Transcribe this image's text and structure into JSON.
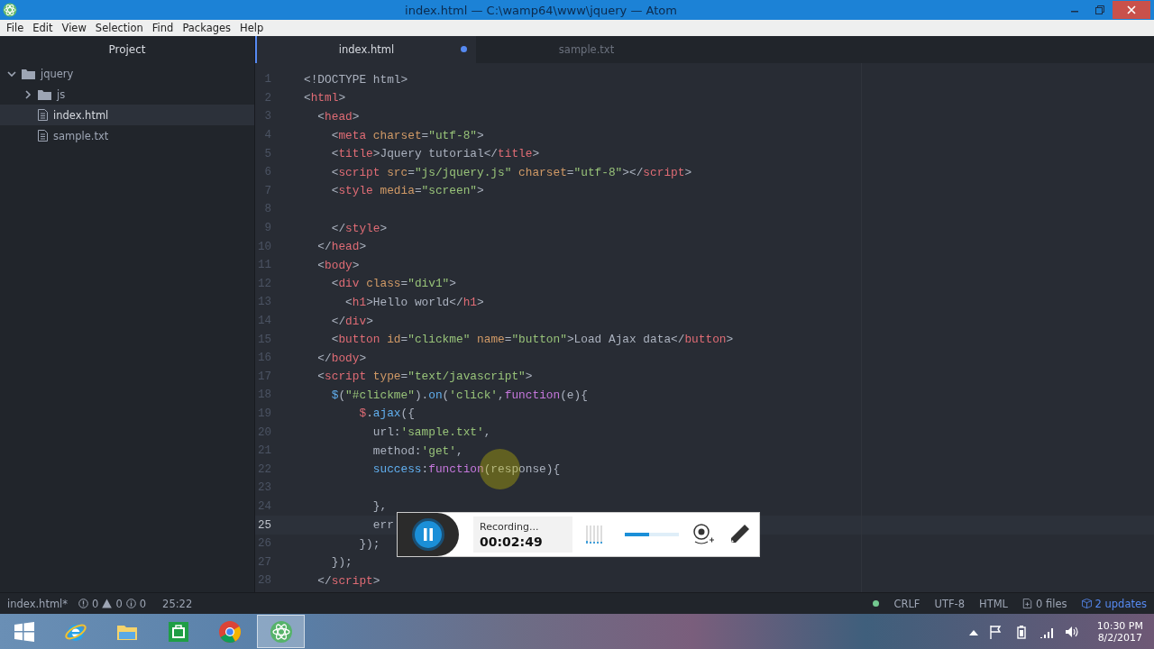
{
  "window": {
    "title": "index.html — C:\\wamp64\\www\\jquery — Atom"
  },
  "menu": [
    "File",
    "Edit",
    "View",
    "Selection",
    "Find",
    "Packages",
    "Help"
  ],
  "sidebar": {
    "title": "Project",
    "tree": [
      {
        "label": "jquery",
        "kind": "folder",
        "expanded": true,
        "selected": false,
        "children": [
          {
            "label": "js",
            "kind": "folder",
            "expanded": false,
            "selected": false
          },
          {
            "label": "index.html",
            "kind": "file",
            "selected": true
          },
          {
            "label": "sample.txt",
            "kind": "file",
            "selected": false
          }
        ]
      }
    ]
  },
  "tabs": [
    {
      "label": "index.html",
      "selected": true,
      "modified": true
    },
    {
      "label": "sample.txt",
      "selected": false,
      "modified": false
    }
  ],
  "code": [
    {
      "number": "1",
      "tokens": [
        {
          "kind": "plain",
          "text": "<!DOCTYPE html>"
        }
      ]
    },
    {
      "number": "2",
      "tokens": [
        {
          "kind": "plain",
          "text": "<"
        },
        {
          "kind": "tag",
          "text": "html"
        },
        {
          "kind": "plain",
          "text": ">"
        }
      ]
    },
    {
      "number": "3",
      "tokens": [
        {
          "kind": "plain",
          "text": "  <"
        },
        {
          "kind": "tag",
          "text": "head"
        },
        {
          "kind": "plain",
          "text": ">"
        }
      ]
    },
    {
      "number": "4",
      "tokens": [
        {
          "kind": "plain",
          "text": "    <"
        },
        {
          "kind": "tag",
          "text": "meta"
        },
        {
          "kind": "attr",
          "text": " charset"
        },
        {
          "kind": "plain",
          "text": "="
        },
        {
          "kind": "string",
          "text": "\"utf-8\""
        },
        {
          "kind": "plain",
          "text": ">"
        }
      ]
    },
    {
      "number": "5",
      "tokens": [
        {
          "kind": "plain",
          "text": "    <"
        },
        {
          "kind": "tag",
          "text": "title"
        },
        {
          "kind": "plain",
          "text": ">Jquery tutorial</"
        },
        {
          "kind": "tag",
          "text": "title"
        },
        {
          "kind": "plain",
          "text": ">"
        }
      ]
    },
    {
      "number": "6",
      "tokens": [
        {
          "kind": "plain",
          "text": "    <"
        },
        {
          "kind": "tag",
          "text": "script"
        },
        {
          "kind": "attr",
          "text": " src"
        },
        {
          "kind": "plain",
          "text": "="
        },
        {
          "kind": "string",
          "text": "\"js/jquery.js\""
        },
        {
          "kind": "attr",
          "text": " charset"
        },
        {
          "kind": "plain",
          "text": "="
        },
        {
          "kind": "string",
          "text": "\"utf-8\""
        },
        {
          "kind": "plain",
          "text": "></"
        },
        {
          "kind": "tag",
          "text": "script"
        },
        {
          "kind": "plain",
          "text": ">"
        }
      ]
    },
    {
      "number": "7",
      "tokens": [
        {
          "kind": "plain",
          "text": "    <"
        },
        {
          "kind": "tag",
          "text": "style"
        },
        {
          "kind": "attr",
          "text": " media"
        },
        {
          "kind": "plain",
          "text": "="
        },
        {
          "kind": "string",
          "text": "\"screen\""
        },
        {
          "kind": "plain",
          "text": ">"
        }
      ]
    },
    {
      "number": "8"
    },
    {
      "number": "9",
      "tokens": [
        {
          "kind": "plain",
          "text": "    </"
        },
        {
          "kind": "tag",
          "text": "style"
        },
        {
          "kind": "plain",
          "text": ">"
        }
      ]
    },
    {
      "number": "10",
      "tokens": [
        {
          "kind": "plain",
          "text": "  </"
        },
        {
          "kind": "tag",
          "text": "head"
        },
        {
          "kind": "plain",
          "text": ">"
        }
      ]
    },
    {
      "number": "11",
      "tokens": [
        {
          "kind": "plain",
          "text": "  <"
        },
        {
          "kind": "tag",
          "text": "body"
        },
        {
          "kind": "plain",
          "text": ">"
        }
      ]
    },
    {
      "number": "12",
      "tokens": [
        {
          "kind": "plain",
          "text": "    <"
        },
        {
          "kind": "tag",
          "text": "div"
        },
        {
          "kind": "attr",
          "text": " class"
        },
        {
          "kind": "plain",
          "text": "="
        },
        {
          "kind": "string",
          "text": "\"div1\""
        },
        {
          "kind": "plain",
          "text": ">"
        }
      ]
    },
    {
      "number": "13",
      "tokens": [
        {
          "kind": "plain",
          "text": "      <"
        },
        {
          "kind": "tag",
          "text": "h1"
        },
        {
          "kind": "plain",
          "text": ">Hello world</"
        },
        {
          "kind": "tag",
          "text": "h1"
        },
        {
          "kind": "plain",
          "text": ">"
        }
      ]
    },
    {
      "number": "14",
      "tokens": [
        {
          "kind": "plain",
          "text": "    </"
        },
        {
          "kind": "tag",
          "text": "div"
        },
        {
          "kind": "plain",
          "text": ">"
        }
      ]
    },
    {
      "number": "15",
      "tokens": [
        {
          "kind": "plain",
          "text": "    <"
        },
        {
          "kind": "tag",
          "text": "button"
        },
        {
          "kind": "attr",
          "text": " id"
        },
        {
          "kind": "plain",
          "text": "="
        },
        {
          "kind": "string",
          "text": "\"clickme\""
        },
        {
          "kind": "attr",
          "text": " name"
        },
        {
          "kind": "plain",
          "text": "="
        },
        {
          "kind": "string",
          "text": "\"button\""
        },
        {
          "kind": "plain",
          "text": ">Load Ajax data</"
        },
        {
          "kind": "tag",
          "text": "button"
        },
        {
          "kind": "plain",
          "text": ">"
        }
      ]
    },
    {
      "number": "16",
      "tokens": [
        {
          "kind": "plain",
          "text": "  </"
        },
        {
          "kind": "tag",
          "text": "body"
        },
        {
          "kind": "plain",
          "text": ">"
        }
      ]
    },
    {
      "number": "17",
      "tokens": [
        {
          "kind": "plain",
          "text": "  <"
        },
        {
          "kind": "tag",
          "text": "script"
        },
        {
          "kind": "attr",
          "text": " type"
        },
        {
          "kind": "plain",
          "text": "="
        },
        {
          "kind": "string",
          "text": "\"text/javascript\""
        },
        {
          "kind": "plain",
          "text": ">"
        }
      ]
    },
    {
      "number": "18",
      "tokens": [
        {
          "kind": "func",
          "text": "    $"
        },
        {
          "kind": "plain",
          "text": "("
        },
        {
          "kind": "string",
          "text": "\"#clickme\""
        },
        {
          "kind": "plain",
          "text": ")."
        },
        {
          "kind": "func",
          "text": "on"
        },
        {
          "kind": "plain",
          "text": "("
        },
        {
          "kind": "string",
          "text": "'click'"
        },
        {
          "kind": "plain",
          "text": ","
        },
        {
          "kind": "keyword",
          "text": "function"
        },
        {
          "kind": "plain",
          "text": "(e){"
        }
      ]
    },
    {
      "number": "19",
      "tokens": [
        {
          "kind": "tag",
          "text": "        $"
        },
        {
          "kind": "plain",
          "text": "."
        },
        {
          "kind": "func",
          "text": "ajax"
        },
        {
          "kind": "plain",
          "text": "({"
        }
      ]
    },
    {
      "number": "20",
      "tokens": [
        {
          "kind": "plain",
          "text": "          url:"
        },
        {
          "kind": "string",
          "text": "'sample.txt'"
        },
        {
          "kind": "plain",
          "text": ","
        }
      ]
    },
    {
      "number": "21",
      "tokens": [
        {
          "kind": "plain",
          "text": "          method:"
        },
        {
          "kind": "string",
          "text": "'get'"
        },
        {
          "kind": "plain",
          "text": ","
        }
      ]
    },
    {
      "number": "22",
      "tokens": [
        {
          "kind": "func",
          "text": "          success"
        },
        {
          "kind": "plain",
          "text": ":"
        },
        {
          "kind": "keyword",
          "text": "function"
        },
        {
          "kind": "plain",
          "text": "(response){"
        }
      ]
    },
    {
      "number": "23"
    },
    {
      "number": "24",
      "tokens": [
        {
          "kind": "plain",
          "text": "          },"
        }
      ]
    },
    {
      "number": "25",
      "current": true,
      "tokens": [
        {
          "kind": "plain",
          "text": "          err"
        }
      ]
    },
    {
      "number": "26",
      "tokens": [
        {
          "kind": "plain",
          "text": "        });"
        }
      ]
    },
    {
      "number": "27",
      "tokens": [
        {
          "kind": "plain",
          "text": "    });"
        }
      ]
    },
    {
      "number": "28",
      "tokens": [
        {
          "kind": "plain",
          "text": "  </"
        },
        {
          "kind": "tag",
          "text": "script"
        },
        {
          "kind": "plain",
          "text": ">"
        }
      ]
    }
  ],
  "status_bar": {
    "file": "index.html*",
    "errors": "0",
    "warnings": "0",
    "infos": "0",
    "cursor": "25:22",
    "line_ending": "CRLF",
    "encoding": "UTF-8",
    "grammar": "HTML",
    "git_files": "0 files",
    "updates": "2 updates"
  },
  "recorder": {
    "status": "Recording...",
    "time": "00:02:49",
    "volume": {
      "level": 0.45
    }
  },
  "taskbar": {
    "apps": [
      {
        "kind": "ie",
        "selected": false
      },
      {
        "kind": "explorer",
        "selected": false
      },
      {
        "kind": "store",
        "selected": false
      },
      {
        "kind": "chrome",
        "selected": false
      },
      {
        "kind": "atom",
        "selected": true
      }
    ],
    "clock": {
      "time": "10:30 PM",
      "date": "8/2/2017"
    }
  }
}
